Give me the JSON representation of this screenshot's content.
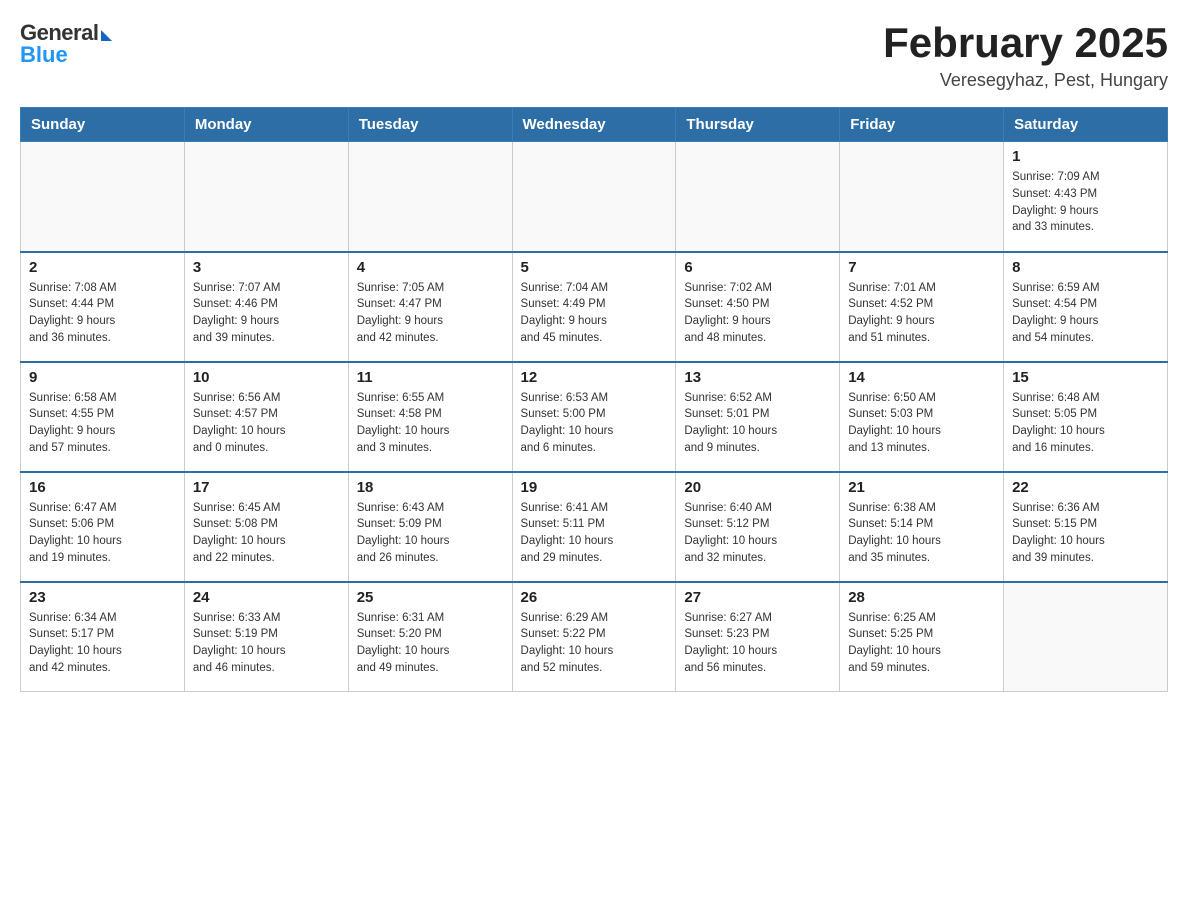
{
  "logo": {
    "general": "General",
    "arrow": "▶",
    "blue": "Blue"
  },
  "title": "February 2025",
  "subtitle": "Veresegyhaz, Pest, Hungary",
  "days_of_week": [
    "Sunday",
    "Monday",
    "Tuesday",
    "Wednesday",
    "Thursday",
    "Friday",
    "Saturday"
  ],
  "weeks": [
    [
      {
        "day": "",
        "info": ""
      },
      {
        "day": "",
        "info": ""
      },
      {
        "day": "",
        "info": ""
      },
      {
        "day": "",
        "info": ""
      },
      {
        "day": "",
        "info": ""
      },
      {
        "day": "",
        "info": ""
      },
      {
        "day": "1",
        "info": "Sunrise: 7:09 AM\nSunset: 4:43 PM\nDaylight: 9 hours\nand 33 minutes."
      }
    ],
    [
      {
        "day": "2",
        "info": "Sunrise: 7:08 AM\nSunset: 4:44 PM\nDaylight: 9 hours\nand 36 minutes."
      },
      {
        "day": "3",
        "info": "Sunrise: 7:07 AM\nSunset: 4:46 PM\nDaylight: 9 hours\nand 39 minutes."
      },
      {
        "day": "4",
        "info": "Sunrise: 7:05 AM\nSunset: 4:47 PM\nDaylight: 9 hours\nand 42 minutes."
      },
      {
        "day": "5",
        "info": "Sunrise: 7:04 AM\nSunset: 4:49 PM\nDaylight: 9 hours\nand 45 minutes."
      },
      {
        "day": "6",
        "info": "Sunrise: 7:02 AM\nSunset: 4:50 PM\nDaylight: 9 hours\nand 48 minutes."
      },
      {
        "day": "7",
        "info": "Sunrise: 7:01 AM\nSunset: 4:52 PM\nDaylight: 9 hours\nand 51 minutes."
      },
      {
        "day": "8",
        "info": "Sunrise: 6:59 AM\nSunset: 4:54 PM\nDaylight: 9 hours\nand 54 minutes."
      }
    ],
    [
      {
        "day": "9",
        "info": "Sunrise: 6:58 AM\nSunset: 4:55 PM\nDaylight: 9 hours\nand 57 minutes."
      },
      {
        "day": "10",
        "info": "Sunrise: 6:56 AM\nSunset: 4:57 PM\nDaylight: 10 hours\nand 0 minutes."
      },
      {
        "day": "11",
        "info": "Sunrise: 6:55 AM\nSunset: 4:58 PM\nDaylight: 10 hours\nand 3 minutes."
      },
      {
        "day": "12",
        "info": "Sunrise: 6:53 AM\nSunset: 5:00 PM\nDaylight: 10 hours\nand 6 minutes."
      },
      {
        "day": "13",
        "info": "Sunrise: 6:52 AM\nSunset: 5:01 PM\nDaylight: 10 hours\nand 9 minutes."
      },
      {
        "day": "14",
        "info": "Sunrise: 6:50 AM\nSunset: 5:03 PM\nDaylight: 10 hours\nand 13 minutes."
      },
      {
        "day": "15",
        "info": "Sunrise: 6:48 AM\nSunset: 5:05 PM\nDaylight: 10 hours\nand 16 minutes."
      }
    ],
    [
      {
        "day": "16",
        "info": "Sunrise: 6:47 AM\nSunset: 5:06 PM\nDaylight: 10 hours\nand 19 minutes."
      },
      {
        "day": "17",
        "info": "Sunrise: 6:45 AM\nSunset: 5:08 PM\nDaylight: 10 hours\nand 22 minutes."
      },
      {
        "day": "18",
        "info": "Sunrise: 6:43 AM\nSunset: 5:09 PM\nDaylight: 10 hours\nand 26 minutes."
      },
      {
        "day": "19",
        "info": "Sunrise: 6:41 AM\nSunset: 5:11 PM\nDaylight: 10 hours\nand 29 minutes."
      },
      {
        "day": "20",
        "info": "Sunrise: 6:40 AM\nSunset: 5:12 PM\nDaylight: 10 hours\nand 32 minutes."
      },
      {
        "day": "21",
        "info": "Sunrise: 6:38 AM\nSunset: 5:14 PM\nDaylight: 10 hours\nand 35 minutes."
      },
      {
        "day": "22",
        "info": "Sunrise: 6:36 AM\nSunset: 5:15 PM\nDaylight: 10 hours\nand 39 minutes."
      }
    ],
    [
      {
        "day": "23",
        "info": "Sunrise: 6:34 AM\nSunset: 5:17 PM\nDaylight: 10 hours\nand 42 minutes."
      },
      {
        "day": "24",
        "info": "Sunrise: 6:33 AM\nSunset: 5:19 PM\nDaylight: 10 hours\nand 46 minutes."
      },
      {
        "day": "25",
        "info": "Sunrise: 6:31 AM\nSunset: 5:20 PM\nDaylight: 10 hours\nand 49 minutes."
      },
      {
        "day": "26",
        "info": "Sunrise: 6:29 AM\nSunset: 5:22 PM\nDaylight: 10 hours\nand 52 minutes."
      },
      {
        "day": "27",
        "info": "Sunrise: 6:27 AM\nSunset: 5:23 PM\nDaylight: 10 hours\nand 56 minutes."
      },
      {
        "day": "28",
        "info": "Sunrise: 6:25 AM\nSunset: 5:25 PM\nDaylight: 10 hours\nand 59 minutes."
      },
      {
        "day": "",
        "info": ""
      }
    ]
  ]
}
